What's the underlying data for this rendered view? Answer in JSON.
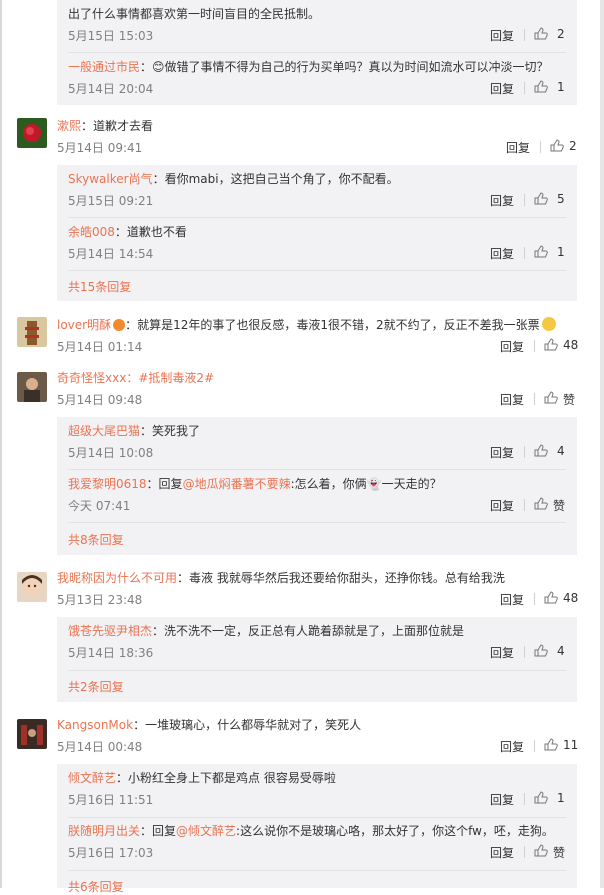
{
  "ui": {
    "reply_label": "回复",
    "like_label": "赞"
  },
  "thread0": {
    "sub": [
      {
        "text": "出了什么事情都喜欢第一时间盲目的全民抵制。",
        "time": "5月15日 15:03",
        "likes": "2"
      },
      {
        "user": "一般通过市民",
        "text": "：😊做错了事情不得为自己的行为买单吗？真以为时间如流水可以冲淡一切？",
        "time": "5月14日 20:04",
        "likes": "1"
      }
    ]
  },
  "thread1": {
    "user": "漱熙",
    "text": "：道歉才去看",
    "time": "5月14日 09:41",
    "likes": "2",
    "sub": [
      {
        "user": "Skywalker尚气",
        "text": "：看你mabi，这把自己当个角了，你不配看。",
        "time": "5月15日 09:21",
        "likes": "5"
      },
      {
        "user": "余皓008",
        "text": "：道歉也不看",
        "time": "5月14日 14:54",
        "likes": "1"
      }
    ],
    "more": "共15条回复"
  },
  "thread2": {
    "user": "lover明酥",
    "text": "：就算是12年的事了也很反感，毒液1很不错，2就不约了，反正不差我一张票",
    "time": "5月14日 01:14",
    "likes": "48"
  },
  "thread3": {
    "user": "奇奇怪怪xxx",
    "text": "：#抵制毒液2#",
    "time": "5月14日 09:48",
    "likes": "赞",
    "sub": [
      {
        "user": "超级大尾巴猫",
        "text": "：笑死我了",
        "time": "5月14日 10:08",
        "likes": "4"
      },
      {
        "user": "我爱黎明0618",
        "text_pre": "：回复",
        "mention": "@地瓜焖番薯不要辣",
        "text": ":怎么着，你俩👻一天走的？",
        "time": "今天 07:41",
        "likes": "赞"
      }
    ],
    "more": "共8条回复"
  },
  "thread4": {
    "user": "我昵称因为什么不可用",
    "text": "：毒液 我就辱华然后我还要给你甜头，还挣你钱。总有给我洗",
    "time": "5月13日 23:48",
    "likes": "48",
    "sub": [
      {
        "user": "饿苍先驱尹相杰",
        "text": "：洗不洗不一定，反正总有人跪着舔就是了，上面那位就是",
        "time": "5月14日 18:36",
        "likes": "4"
      }
    ],
    "more": "共2条回复"
  },
  "thread5": {
    "user": "KangsonMok",
    "text": "：一堆玻璃心，什么都辱华就对了，笑死人",
    "time": "5月14日 00:48",
    "likes": "11",
    "sub": [
      {
        "user": "倾文醉艺",
        "text": "：小粉红全身上下都是鸡点 很容易受辱啦",
        "time": "5月16日 11:51",
        "likes": "1"
      },
      {
        "user": "朕随明月出关",
        "text_pre": "：回复",
        "mention": "@倾文醉艺",
        "text": ":这么说你不是玻璃心咯，那太好了，你这个fw，呸，走狗。",
        "time": "5月16日 17:03",
        "likes": "赞"
      }
    ],
    "more": "共6条回复"
  },
  "colors": {
    "link": "#eb7350",
    "meta": "#808080",
    "sub_bg": "#f2f2f5"
  }
}
